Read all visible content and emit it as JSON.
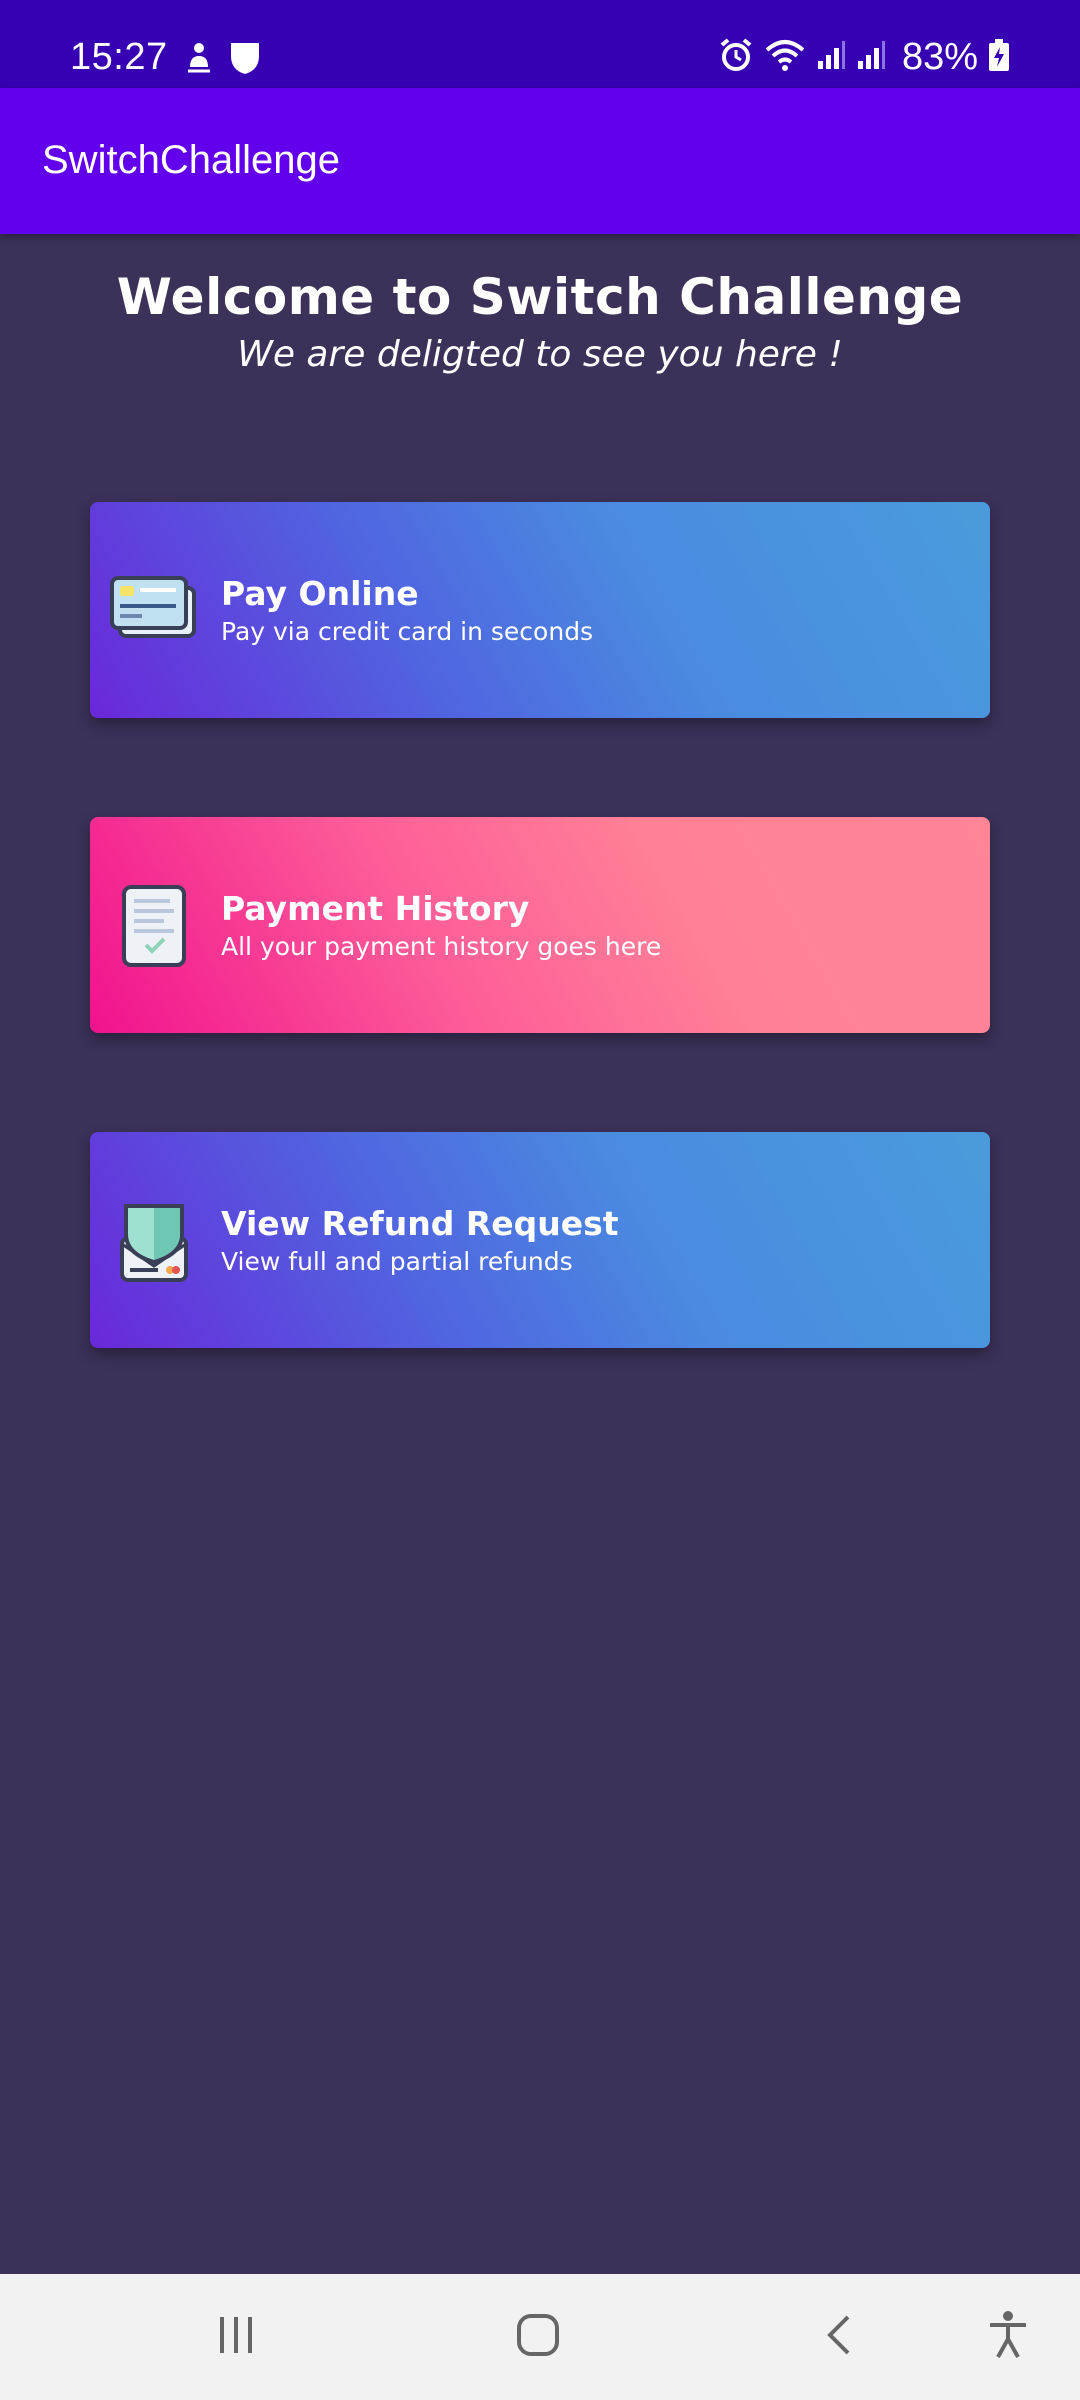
{
  "status_bar": {
    "time": "15:27",
    "battery": "83%",
    "icons": [
      "person-icon",
      "shield-icon",
      "alarm-icon",
      "wifi-icon",
      "signal-icon",
      "signal-icon",
      "battery-charging-icon"
    ]
  },
  "app_bar": {
    "title": "SwitchChallenge"
  },
  "welcome": {
    "title": "Welcome to Switch Challenge",
    "subtitle": "We are deligted to see you here !"
  },
  "cards": [
    {
      "title": "Pay Online",
      "subtitle": "Pay via credit card in seconds",
      "icon": "credit-card-icon"
    },
    {
      "title": "Payment History",
      "subtitle": "All your payment history goes here",
      "icon": "receipt-icon"
    },
    {
      "title": "View Refund Request",
      "subtitle": "View full and partial refunds",
      "icon": "refund-shield-icon"
    }
  ],
  "nav_bar": {
    "buttons": [
      "recents-icon",
      "home-icon",
      "back-icon",
      "accessibility-icon"
    ]
  },
  "colors": {
    "status_bar": "#3700b3",
    "app_bar": "#6200ee",
    "background": "#3c3159",
    "card_blue_start": "#6a28d9",
    "card_blue_end": "#4a9bdc",
    "card_pink_start": "#f1128e",
    "card_pink_end": "#ff8597"
  }
}
